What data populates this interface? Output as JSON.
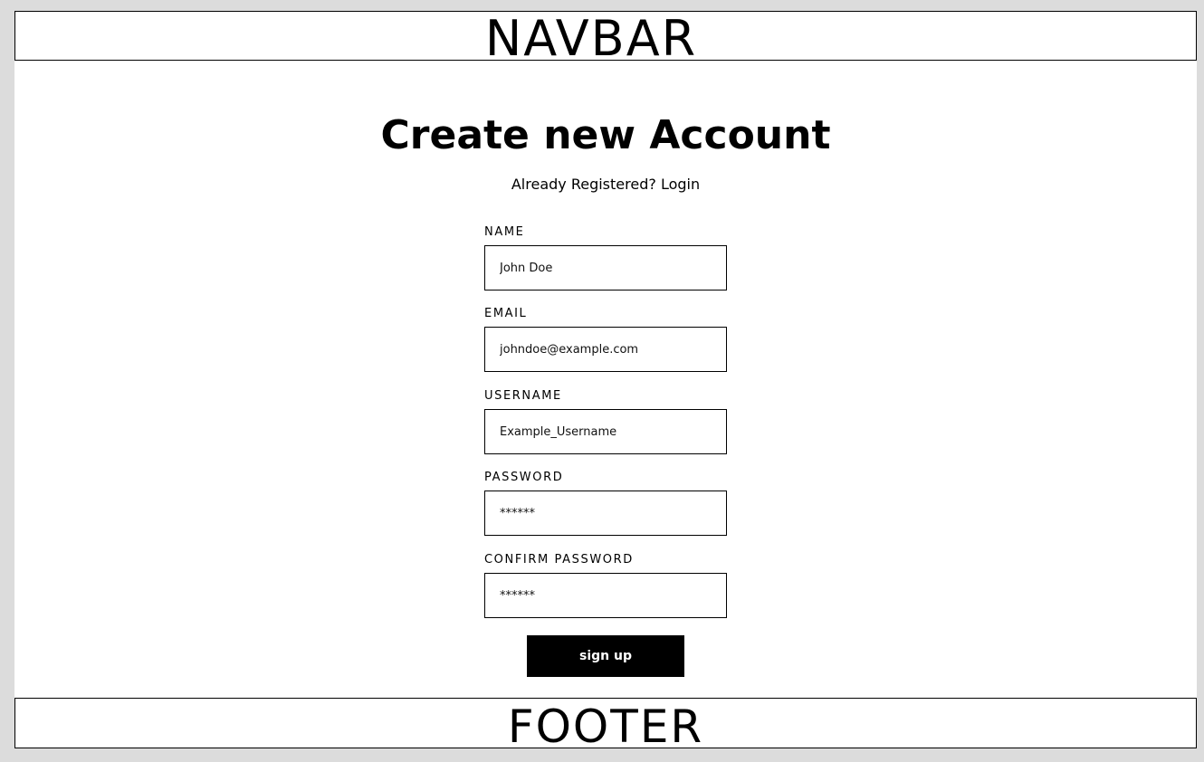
{
  "navbar": {
    "label": "NAVBAR"
  },
  "footer": {
    "label": "FOOTER"
  },
  "heading": {
    "title": "Create new Account"
  },
  "subline": {
    "prefix": "Already Registered?",
    "login_link": "Login"
  },
  "form": {
    "fields": [
      {
        "label": "NAME",
        "placeholder": "John Doe",
        "type": "text"
      },
      {
        "label": "EMAIL",
        "placeholder": "johndoe@example.com",
        "type": "email"
      },
      {
        "label": "USERNAME",
        "placeholder": "Example_Username",
        "type": "text"
      },
      {
        "label": "PASSWORD",
        "placeholder": "******",
        "type": "password"
      },
      {
        "label": "CONFIRM PASSWORD",
        "placeholder": "******",
        "type": "password"
      }
    ],
    "submit_label": "sign up"
  }
}
